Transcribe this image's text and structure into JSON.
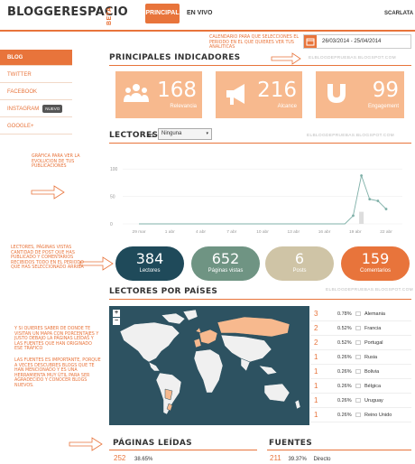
{
  "header": {
    "logo": "BLOGGERESPACIO",
    "beta": "BETA",
    "tabs": [
      {
        "label": "PRINCIPAL",
        "active": true
      },
      {
        "label": "EN VIVO",
        "active": false
      }
    ],
    "user": "SCARLATA"
  },
  "sidebar": {
    "items": [
      {
        "label": "BLOG",
        "active": true
      },
      {
        "label": "TWITTER",
        "active": false
      },
      {
        "label": "FACEBOOK",
        "active": false
      },
      {
        "label": "INSTAGRAM",
        "active": false,
        "badge": "NUEVO"
      },
      {
        "label": "GOOGLE+",
        "active": false
      }
    ]
  },
  "notes": {
    "calendar": "CALENDARIO PARA QUE SELECCIONES EL PERIODO EN EL QUE QUIERES VER TUS ANALITICAS",
    "graph": "GRÁFICA PARA VER LA EVOLUCION DE TUS PUBLICACIONES",
    "readers": "LECTORES, PÁGINAS VISTAS CANTIDAD DE POST QUE HAS PUBLICADO Y COMENTARIOS RECIBIDOS TODO EN EL PERIODO QUE HAS SELECCIONADO ARRIBA",
    "map": "Y SI QUIERES SABER DE DONDE TE VISITAN UN MAPA CON PORCENTAJES Y JUSTO DEBAJO LA PÁGINAS LEÍDAS Y LAS FUENTES QUE HAN ORIGINADO ESE TRÁFICO",
    "sources": "LAS FUENTES ES IMPORTANTE, PORQUE A VECES DESCUBRES BLOGS QUE TE HAN MENCIONADO Y ES UNA HERRAMIENTA MUY ÚTIL PARA SER AGRADECIDO Y CONOCER BLOGS NUEVOS."
  },
  "date_range": "26/03/2014 - 25/04/2014",
  "indicators": {
    "title": "PRINCIPALES INDICADORES",
    "url": "ELBLOGDEPRUEBAS.BLOGSPOT.COM",
    "items": [
      {
        "value": "168",
        "label": "Relevancia",
        "icon": "people-icon"
      },
      {
        "value": "216",
        "label": "Alcance",
        "icon": "megaphone-icon"
      },
      {
        "value": "99",
        "label": "Engagement",
        "icon": "magnet-icon"
      }
    ]
  },
  "readers": {
    "title": "LECTORES",
    "vs": "vs",
    "compare_value": "Ninguna",
    "url": "ELBLOGDEPRUEBAS.BLOGSPOT.COM"
  },
  "chart_data": {
    "type": "line",
    "title": "",
    "xlabel": "",
    "ylabel": "",
    "categories": [
      "29 mar",
      "1 abr",
      "4 abr",
      "7 abr",
      "10 abr",
      "13 abr",
      "16 abr",
      "19 abr",
      "22 abr"
    ],
    "y_ticks": [
      0,
      50,
      100
    ],
    "ylim": [
      0,
      125
    ],
    "grid": true,
    "series": [
      {
        "values": [
          0,
          0,
          0,
          0,
          0,
          0,
          0,
          0,
          0,
          0,
          0,
          0,
          0,
          0,
          0,
          0,
          0,
          0,
          0,
          0,
          0,
          0,
          0,
          0,
          0,
          0,
          15,
          88,
          45,
          42,
          27
        ]
      }
    ],
    "bar_marker": {
      "index": 27,
      "value": 22
    }
  },
  "summary": [
    {
      "value": "384",
      "label": "Lectores",
      "color": "#1f4a5a"
    },
    {
      "value": "652",
      "label": "Páginas vistas",
      "color": "#6f9483"
    },
    {
      "value": "6",
      "label": "Posts",
      "color": "#cfc4a6"
    },
    {
      "value": "159",
      "label": "Comentarios",
      "color": "#e8743b"
    }
  ],
  "countries": {
    "title": "LECTORES POR PAÍSES",
    "url": "ELBLOGDEPRUEBAS.BLOGSPOT.COM",
    "rows": [
      {
        "n": "3",
        "pct": "0.78%",
        "name": "Alemania"
      },
      {
        "n": "2",
        "pct": "0.52%",
        "name": "Francia"
      },
      {
        "n": "2",
        "pct": "0.52%",
        "name": "Portugal"
      },
      {
        "n": "1",
        "pct": "0.26%",
        "name": "Rusia"
      },
      {
        "n": "1",
        "pct": "0.26%",
        "name": "Bolivia"
      },
      {
        "n": "1",
        "pct": "0.26%",
        "name": "Bélgica"
      },
      {
        "n": "1",
        "pct": "0.26%",
        "name": "Uruguay"
      },
      {
        "n": "1",
        "pct": "0.26%",
        "name": "Reino Unido"
      }
    ],
    "zoom_in": "+",
    "zoom_out": "−"
  },
  "pages_read": {
    "title": "PÁGINAS LEÍDAS",
    "first": {
      "n": "252",
      "pct": "38.65%"
    }
  },
  "sources": {
    "title": "FUENTES",
    "first": {
      "n": "211",
      "pct": "39.37%",
      "name": "Directo"
    }
  },
  "colors": {
    "accent": "#e8743b",
    "kpi": "#f7b98e",
    "map_bg": "#2d5261",
    "land": "#f0f0f0",
    "land_hl": "#f7b98e"
  }
}
